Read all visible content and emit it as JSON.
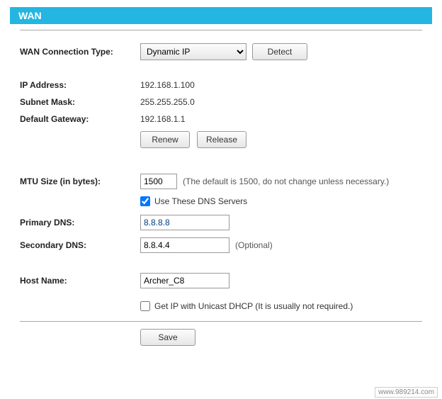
{
  "header": {
    "title": "WAN"
  },
  "connection": {
    "label": "WAN Connection Type:",
    "selected": "Dynamic IP",
    "detect_label": "Detect"
  },
  "ip": {
    "address_label": "IP Address:",
    "address_value": "192.168.1.100",
    "subnet_label": "Subnet Mask:",
    "subnet_value": "255.255.255.0",
    "gateway_label": "Default Gateway:",
    "gateway_value": "192.168.1.1",
    "renew_label": "Renew",
    "release_label": "Release"
  },
  "mtu": {
    "label": "MTU Size (in bytes):",
    "value": "1500",
    "hint": "(The default is 1500, do not change unless necessary.)"
  },
  "dns": {
    "use_label": "Use These DNS Servers",
    "use_checked": true,
    "primary_label": "Primary DNS:",
    "primary_value": "8.8.8.8",
    "secondary_label": "Secondary DNS:",
    "secondary_value": "8.8.4.4",
    "optional_hint": "(Optional)"
  },
  "host": {
    "label": "Host Name:",
    "value": "Archer_C8"
  },
  "unicast": {
    "label": "Get IP with Unicast DHCP (It is usually not required.)",
    "checked": false
  },
  "actions": {
    "save_label": "Save"
  },
  "watermark": "www.989214.com"
}
